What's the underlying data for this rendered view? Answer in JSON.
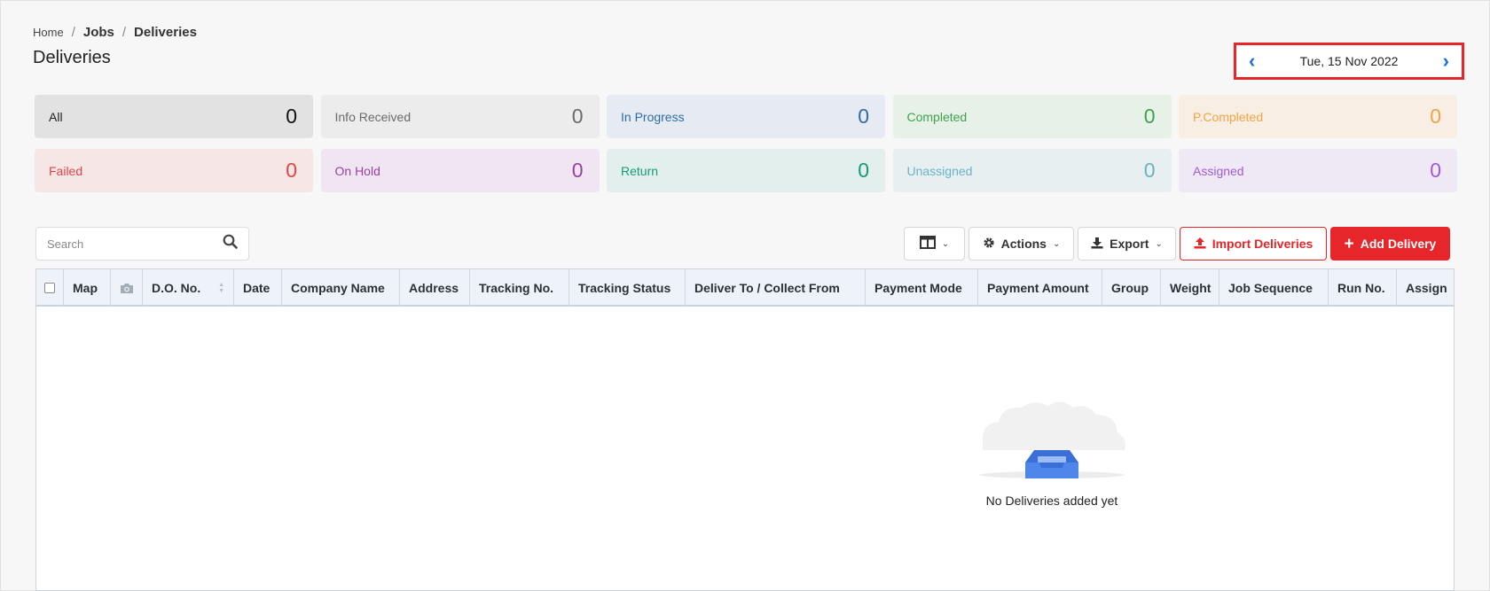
{
  "breadcrumb": {
    "home": "Home",
    "jobs": "Jobs",
    "current": "Deliveries"
  },
  "page_title": "Deliveries",
  "date_nav": {
    "date": "Tue, 15 Nov 2022",
    "prev_icon": "chevron-left-icon",
    "next_icon": "chevron-right-icon"
  },
  "stats": [
    {
      "label": "All",
      "count": "0",
      "bg": "#e2e2e2",
      "fg": "#222222",
      "countColor": "#111111"
    },
    {
      "label": "Info Received",
      "count": "0",
      "bg": "#ececec",
      "fg": "#6b6b6b",
      "countColor": "#6b6b6b"
    },
    {
      "label": "In Progress",
      "count": "0",
      "bg": "#e6ebf3",
      "fg": "#2e6da4",
      "countColor": "#2e6da4"
    },
    {
      "label": "Completed",
      "count": "0",
      "bg": "#e7f1e7",
      "fg": "#3fa34d",
      "countColor": "#3fa34d"
    },
    {
      "label": "P.Completed",
      "count": "0",
      "bg": "#f8eee3",
      "fg": "#f0a545",
      "countColor": "#f0a545"
    },
    {
      "label": "Failed",
      "count": "0",
      "bg": "#f6e6e6",
      "fg": "#e04545",
      "countColor": "#e04545"
    },
    {
      "label": "On Hold",
      "count": "0",
      "bg": "#f0e6f1",
      "fg": "#9b3fa6",
      "countColor": "#9b3fa6"
    },
    {
      "label": "Return",
      "count": "0",
      "bg": "#e2efec",
      "fg": "#129c78",
      "countColor": "#129c78"
    },
    {
      "label": "Unassigned",
      "count": "0",
      "bg": "#e8eff1",
      "fg": "#67b3c6",
      "countColor": "#67b3c6"
    },
    {
      "label": "Assigned",
      "count": "0",
      "bg": "#efe9f6",
      "fg": "#a05ad4",
      "countColor": "#a05ad4"
    }
  ],
  "toolbar": {
    "search_placeholder": "Search",
    "actions_label": "Actions",
    "export_label": "Export",
    "import_label": "Import Deliveries",
    "add_label": "Add Delivery"
  },
  "table": {
    "columns": [
      "Map",
      "D.O. No.",
      "Date",
      "Company Name",
      "Address",
      "Tracking No.",
      "Tracking Status",
      "Deliver To / Collect From",
      "Payment Mode",
      "Payment Amount",
      "Group",
      "Weight",
      "Job Sequence",
      "Run No.",
      "Assign"
    ],
    "empty_text": "No Deliveries added yet"
  },
  "colors": {
    "accent_red": "#e6262a",
    "link_blue": "#1a6fe0"
  }
}
